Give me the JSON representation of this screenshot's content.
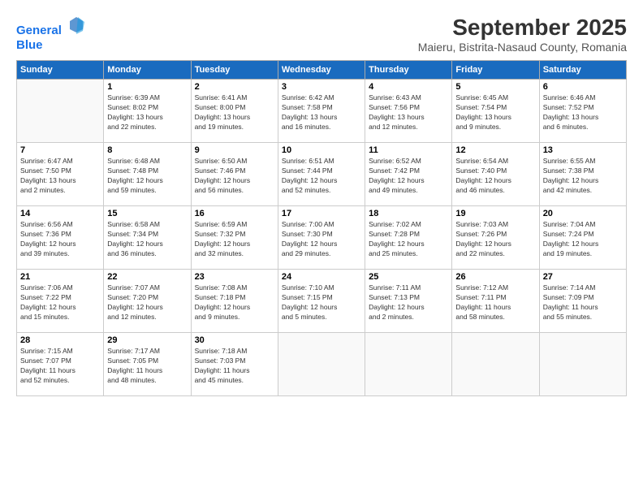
{
  "header": {
    "logo_line1": "General",
    "logo_line2": "Blue",
    "title": "September 2025",
    "subtitle": "Maieru, Bistrita-Nasaud County, Romania"
  },
  "weekdays": [
    "Sunday",
    "Monday",
    "Tuesday",
    "Wednesday",
    "Thursday",
    "Friday",
    "Saturday"
  ],
  "weeks": [
    [
      {
        "day": "",
        "info": ""
      },
      {
        "day": "1",
        "info": "Sunrise: 6:39 AM\nSunset: 8:02 PM\nDaylight: 13 hours\nand 22 minutes."
      },
      {
        "day": "2",
        "info": "Sunrise: 6:41 AM\nSunset: 8:00 PM\nDaylight: 13 hours\nand 19 minutes."
      },
      {
        "day": "3",
        "info": "Sunrise: 6:42 AM\nSunset: 7:58 PM\nDaylight: 13 hours\nand 16 minutes."
      },
      {
        "day": "4",
        "info": "Sunrise: 6:43 AM\nSunset: 7:56 PM\nDaylight: 13 hours\nand 12 minutes."
      },
      {
        "day": "5",
        "info": "Sunrise: 6:45 AM\nSunset: 7:54 PM\nDaylight: 13 hours\nand 9 minutes."
      },
      {
        "day": "6",
        "info": "Sunrise: 6:46 AM\nSunset: 7:52 PM\nDaylight: 13 hours\nand 6 minutes."
      }
    ],
    [
      {
        "day": "7",
        "info": "Sunrise: 6:47 AM\nSunset: 7:50 PM\nDaylight: 13 hours\nand 2 minutes."
      },
      {
        "day": "8",
        "info": "Sunrise: 6:48 AM\nSunset: 7:48 PM\nDaylight: 12 hours\nand 59 minutes."
      },
      {
        "day": "9",
        "info": "Sunrise: 6:50 AM\nSunset: 7:46 PM\nDaylight: 12 hours\nand 56 minutes."
      },
      {
        "day": "10",
        "info": "Sunrise: 6:51 AM\nSunset: 7:44 PM\nDaylight: 12 hours\nand 52 minutes."
      },
      {
        "day": "11",
        "info": "Sunrise: 6:52 AM\nSunset: 7:42 PM\nDaylight: 12 hours\nand 49 minutes."
      },
      {
        "day": "12",
        "info": "Sunrise: 6:54 AM\nSunset: 7:40 PM\nDaylight: 12 hours\nand 46 minutes."
      },
      {
        "day": "13",
        "info": "Sunrise: 6:55 AM\nSunset: 7:38 PM\nDaylight: 12 hours\nand 42 minutes."
      }
    ],
    [
      {
        "day": "14",
        "info": "Sunrise: 6:56 AM\nSunset: 7:36 PM\nDaylight: 12 hours\nand 39 minutes."
      },
      {
        "day": "15",
        "info": "Sunrise: 6:58 AM\nSunset: 7:34 PM\nDaylight: 12 hours\nand 36 minutes."
      },
      {
        "day": "16",
        "info": "Sunrise: 6:59 AM\nSunset: 7:32 PM\nDaylight: 12 hours\nand 32 minutes."
      },
      {
        "day": "17",
        "info": "Sunrise: 7:00 AM\nSunset: 7:30 PM\nDaylight: 12 hours\nand 29 minutes."
      },
      {
        "day": "18",
        "info": "Sunrise: 7:02 AM\nSunset: 7:28 PM\nDaylight: 12 hours\nand 25 minutes."
      },
      {
        "day": "19",
        "info": "Sunrise: 7:03 AM\nSunset: 7:26 PM\nDaylight: 12 hours\nand 22 minutes."
      },
      {
        "day": "20",
        "info": "Sunrise: 7:04 AM\nSunset: 7:24 PM\nDaylight: 12 hours\nand 19 minutes."
      }
    ],
    [
      {
        "day": "21",
        "info": "Sunrise: 7:06 AM\nSunset: 7:22 PM\nDaylight: 12 hours\nand 15 minutes."
      },
      {
        "day": "22",
        "info": "Sunrise: 7:07 AM\nSunset: 7:20 PM\nDaylight: 12 hours\nand 12 minutes."
      },
      {
        "day": "23",
        "info": "Sunrise: 7:08 AM\nSunset: 7:18 PM\nDaylight: 12 hours\nand 9 minutes."
      },
      {
        "day": "24",
        "info": "Sunrise: 7:10 AM\nSunset: 7:15 PM\nDaylight: 12 hours\nand 5 minutes."
      },
      {
        "day": "25",
        "info": "Sunrise: 7:11 AM\nSunset: 7:13 PM\nDaylight: 12 hours\nand 2 minutes."
      },
      {
        "day": "26",
        "info": "Sunrise: 7:12 AM\nSunset: 7:11 PM\nDaylight: 11 hours\nand 58 minutes."
      },
      {
        "day": "27",
        "info": "Sunrise: 7:14 AM\nSunset: 7:09 PM\nDaylight: 11 hours\nand 55 minutes."
      }
    ],
    [
      {
        "day": "28",
        "info": "Sunrise: 7:15 AM\nSunset: 7:07 PM\nDaylight: 11 hours\nand 52 minutes."
      },
      {
        "day": "29",
        "info": "Sunrise: 7:17 AM\nSunset: 7:05 PM\nDaylight: 11 hours\nand 48 minutes."
      },
      {
        "day": "30",
        "info": "Sunrise: 7:18 AM\nSunset: 7:03 PM\nDaylight: 11 hours\nand 45 minutes."
      },
      {
        "day": "",
        "info": ""
      },
      {
        "day": "",
        "info": ""
      },
      {
        "day": "",
        "info": ""
      },
      {
        "day": "",
        "info": ""
      }
    ]
  ]
}
